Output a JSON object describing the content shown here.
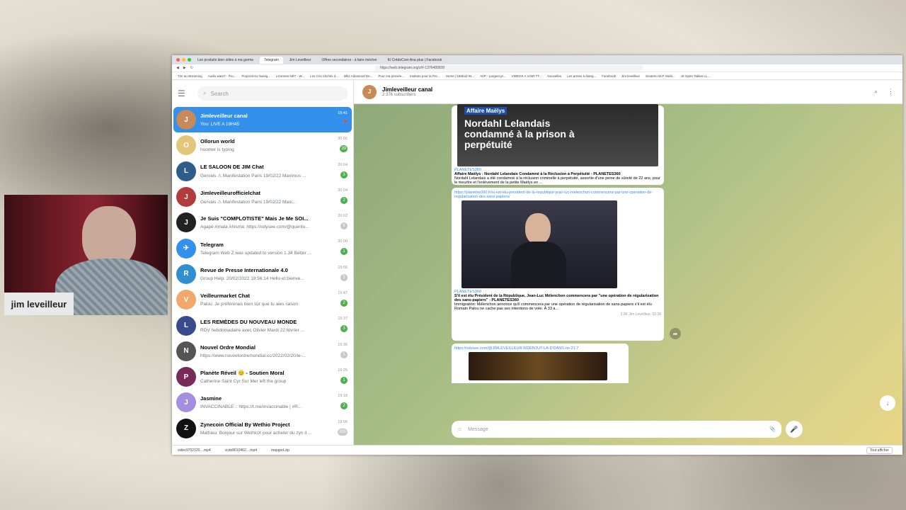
{
  "browser": {
    "tabs": [
      "Les produits bien utiles à ma germe",
      "Telegram",
      "Jim Leveilleur",
      "Offres secondaires - à faire mécher",
      "Ki CrédoCom Ana plus | Facebook"
    ],
    "url": "https://web.telegram.org/z/#-1376489939",
    "bookmarks": [
      "Tim au streaming",
      "Audio ware7 - Pro...",
      "ProjectSAU Suivig...",
      "LGonnes NET - W...",
      "Les Cris Clichés d...",
      "Bltiz Advanced De...",
      "Pour ma pensée...",
      "Instituts pour la Pre...",
      "Home | DEBUZ IN...",
      "AVP - Largest pr...",
      "VIDEOS A VOIR TT...",
      "Nouvelles",
      "Les armes à étang...",
      "Facebook",
      "Jim leveilleur",
      "Soutenu W.P. Multi...",
      "JS Open Tables LL..."
    ],
    "downloads": [
      "video9702120....mp4",
      "vcdo8010462....mp4",
      "mapgod.zip"
    ],
    "show_all": "Tout afficher"
  },
  "sidebar": {
    "search_placeholder": "Search",
    "chats": [
      {
        "title": "Jimleveilleur canal",
        "sub": "You: LIVE A 19H45",
        "time": "19:41",
        "badge": "",
        "color": "#c98a5a",
        "initial": "J",
        "active": true
      },
      {
        "title": "Ollorun world",
        "sub": "hoomer is typing",
        "time": "20:05",
        "badge": "39",
        "color": "#e3c679",
        "initial": "O"
      },
      {
        "title": "LE SALOON DE JIM Chat",
        "sub": "Gervais ⚠ Manifestation Paris 19/02/22 Maximus ...",
        "time": "20:04",
        "badge": "3",
        "color": "#2d5d8a",
        "initial": "L"
      },
      {
        "title": "Jimleveilleurofficielchat",
        "sub": "Gervais ⚠ Manifestation Paris 19/02/22 Maxi...",
        "time": "20:04",
        "badge": "2",
        "color": "#b33b3b",
        "initial": "J"
      },
      {
        "title": "Je Suis \"COMPLOTISTE\" Mais Je Me SOI...",
        "sub": "Agapè Amala Ahisma: https://odysee.com/@quentu...",
        "time": "20:02",
        "badge": "5",
        "color": "#222222",
        "initial": "J",
        "muted": true
      },
      {
        "title": "Telegram",
        "sub": "Telegram Web Z was updated to version 1.34 Better ...",
        "time": "20:00",
        "badge": "1",
        "color": "#3390ec",
        "initial": "✈"
      },
      {
        "title": "Revue de Presse Internationale 4.0",
        "sub": "Group Help: 20/02/2022 19:56:14 Hello et bienve...",
        "time": "19:56",
        "badge": "3",
        "color": "#2f8fcf",
        "initial": "R",
        "muted": true
      },
      {
        "title": "Veilleurmarket Chat",
        "sub": "Palou: Je préférerais bien sûr que tu aies raison",
        "time": "19:47",
        "badge": "2",
        "color": "#f3a86b",
        "initial": "V"
      },
      {
        "title": "LES REMÈDES DU NOUVEAU MONDE",
        "sub": "RDV hebdomadaire avec Olivier Mardi 22 février ...",
        "time": "19:37",
        "badge": "3",
        "color": "#3a4a8a",
        "initial": "L"
      },
      {
        "title": "Nouvel Ordre Mondial",
        "sub": "https://www.nouvelordremondial.cc/2022/02/20/le-...",
        "time": "19:36",
        "badge": "5",
        "color": "#555555",
        "initial": "N",
        "muted": true
      },
      {
        "title": "Planète Réveil 😊 - Soutien Moral",
        "sub": "Catherine Saint Cyr Sur Mer left the group",
        "time": "19:25",
        "badge": "1",
        "color": "#7a2a5a",
        "initial": "P"
      },
      {
        "title": "Jasmine",
        "sub": "INVACCINABLE :: https://t.me/invaccinable | #R...",
        "time": "19:18",
        "badge": "2",
        "color": "#a48ee0",
        "initial": "J"
      },
      {
        "title": "Zynecoin Official By Wethio Project",
        "sub": "Mathieu: Bonjour sur WethioX pour acheter du zyn il ...",
        "time": "19:06",
        "badge": "335",
        "color": "#111111",
        "initial": "Z",
        "muted": true
      }
    ]
  },
  "channel": {
    "title": "Jimleveilleur canal",
    "subscribers": "2 376 subscribers"
  },
  "messages": [
    {
      "tag": "Affaire Maëlys",
      "headline": "Nordahl Lelandais condamné à la prison à perpétuité",
      "source": "PLANETES360",
      "title": "Affaire Maëlys : Nordahl Lelandais Condamné à la Réclusion à Perpétuité - PLANETES360",
      "desc": "Nordahl Lelandais a été condamné à la réclusion criminelle à perpétuité, assortie d'une peine de sûreté de 22 ans, pour le meurtre et l'enlèvement de la petite Maëlys en ...",
      "meta": "2.8K  Jim Leveilleur, 02:38"
    },
    {
      "link": "https://planetes360.fr/si-est-elu-president-de-la-republique-jean-luc-melenchon-commencera-par-une-operation-de-regularisation-des-sans-papiers/",
      "source": "PLANETES360",
      "title": "S'il est élu Président de la République, Jean-Luc Mélenchon commencera par \"une opération de régularisation des sans-papiers\" - PLANETES360",
      "desc": "Immigration: Mélenchon annonce qu'il commencera par une opération de régularisation de sans-papiers s'il est élu Romain Palou ne cache pas ses intentions de vote. À 33 a...",
      "meta": "2.8K  Jim Leveilleur, 02:38"
    },
    {
      "link": "https://odysee.com/@JIMLEVEILLEUR:9/DEBOUT-LA-D'DANS-no-21:7"
    }
  ],
  "composer": {
    "placeholder": "Message"
  },
  "webcam": {
    "name": "jim leveilleur"
  }
}
